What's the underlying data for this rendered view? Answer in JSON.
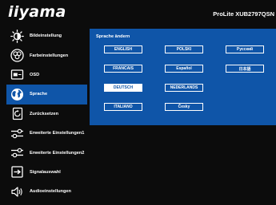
{
  "header": {
    "logo": "iiyama",
    "model": "ProLite XUB2797QSN"
  },
  "sidebar": {
    "items": [
      {
        "label": "Bildeinstellung",
        "icon": "brightness-icon"
      },
      {
        "label": "Farbeinstellungen",
        "icon": "color-palette-icon"
      },
      {
        "label": "OSD",
        "icon": "osd-icon"
      },
      {
        "label": "Sprache",
        "icon": "globe-icon",
        "active": true
      },
      {
        "label": "Zurücksetzen",
        "icon": "reset-icon"
      },
      {
        "label": "Erweiterte Einstellungen1",
        "icon": "sliders-icon"
      },
      {
        "label": "Erweiterte Einstellungen2",
        "icon": "sliders-icon"
      },
      {
        "label": "Signalauswahl",
        "icon": "input-signal-icon"
      },
      {
        "label": "Audioeinstellungen",
        "icon": "speaker-icon"
      }
    ]
  },
  "panel": {
    "title": "Sprache ändern",
    "languages": [
      "ENGLISH",
      "POLSKI",
      "Русский",
      "FRANCAIS",
      "Español",
      "日本語",
      "DEUTSCH",
      "NEDERLANDS",
      "ITALIANO",
      "Česky"
    ],
    "selected": "DEUTSCH"
  },
  "colors": {
    "background": "#0c0c0c",
    "accent": "#0f55a8",
    "text": "#ffffff"
  }
}
